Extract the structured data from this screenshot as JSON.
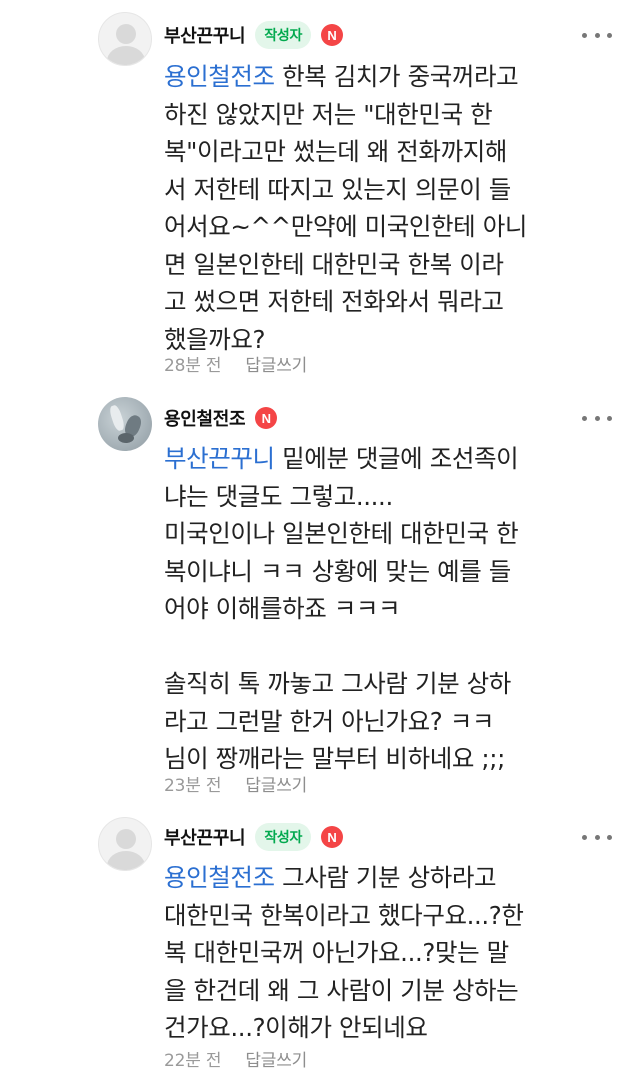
{
  "comments": [
    {
      "nickname": "부산끈꾸니",
      "author_badge": "작성자",
      "n_badge": "N",
      "mention": "용인철전조",
      "lines": [
        " 한복 김치가 중국꺼라고",
        "하진 않았지만 저는 \"대한민국 한",
        "복\"이라고만 썼는데 왜 전화까지해",
        "서 저한테 따지고 있는지 의문이 들",
        "어서요~^^만약에 미국인한테 아니",
        "면 일본인한테 대한민국 한복 이라",
        "고 썼으면 저한테 전화와서 뭐라고",
        "했을까요?"
      ],
      "time": "28분 전",
      "reply_label": "답글쓰기",
      "avatar": "default-avatar-icon"
    },
    {
      "nickname": "용인철전조",
      "n_badge": "N",
      "mention": "부산끈꾸니",
      "lines": [
        " 밑에분 댓글에 조선족이",
        "냐는 댓글도 그렇고.....",
        "미국인이나 일본인한테 대한민국 한",
        "복이냐니 ㅋㅋ 상황에 맞는 예를 들",
        "어야 이해를하죠 ㅋㅋㅋ",
        "",
        "솔직히 톡 까놓고 그사람 기분 상하",
        "라고 그런말 한거 아닌가요? ㅋㅋ",
        "님이 짱깨라는 말부터 비하네요 ;;;"
      ],
      "time": "23분 전",
      "reply_label": "답글쓰기",
      "avatar": "profile-photo"
    },
    {
      "nickname": "부산끈꾸니",
      "author_badge": "작성자",
      "n_badge": "N",
      "mention": "용인철전조",
      "lines": [
        " 그사람 기분 상하라고",
        "대한민국 한복이라고 했다구요...?한",
        "복 대한민국꺼 아닌가요...?맞는 말",
        "을 한건데 왜 그 사람이 기분 상하는",
        "건가요...?이해가 안되네요"
      ],
      "time": "22분 전",
      "reply_label": "답글쓰기",
      "avatar": "default-avatar-icon"
    }
  ],
  "colors": {
    "mention": "#2b6fd1",
    "author_badge_bg": "#e3f6ea",
    "author_badge_text": "#03a94f",
    "n_badge_bg": "#f44546",
    "meta_text": "#9a9a9a"
  }
}
